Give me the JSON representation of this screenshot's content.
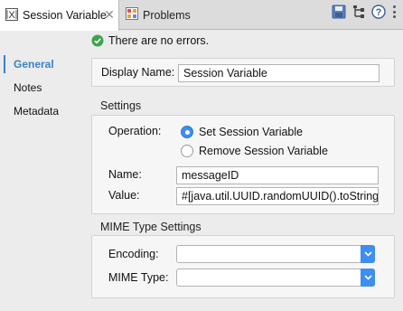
{
  "tabs": {
    "active": {
      "label": "Session Variable",
      "icon": "session-variable-icon"
    },
    "inactive": {
      "label": "Problems",
      "icon": "problems-icon"
    },
    "close": "✕"
  },
  "toolbar": {
    "icons": [
      "save-icon",
      "tree-icon",
      "help-icon",
      "view-menu-icon"
    ],
    "help_glyph": "?"
  },
  "status": {
    "text": "There are no errors.",
    "icon": "check-circle-icon",
    "color": "#3ea34a"
  },
  "nav": {
    "items": [
      {
        "label": "General",
        "active": true
      },
      {
        "label": "Notes",
        "active": false
      },
      {
        "label": "Metadata",
        "active": false
      }
    ],
    "accent": "#3a82c9"
  },
  "general": {
    "display_name_label": "Display Name:",
    "display_name_value": "Session Variable"
  },
  "settings": {
    "title": "Settings",
    "operation_label": "Operation:",
    "options": [
      {
        "label": "Set Session Variable",
        "selected": true
      },
      {
        "label": "Remove Session Variable",
        "selected": false
      }
    ],
    "name_label": "Name:",
    "name_value": "messageID",
    "value_label": "Value:",
    "value_value": "#[java.util.UUID.randomUUID().toString()]"
  },
  "mime": {
    "title": "MIME Type Settings",
    "encoding_label": "Encoding:",
    "encoding_value": "",
    "mime_type_label": "MIME Type:",
    "mime_type_value": "",
    "accent": "#3d8ef0"
  }
}
